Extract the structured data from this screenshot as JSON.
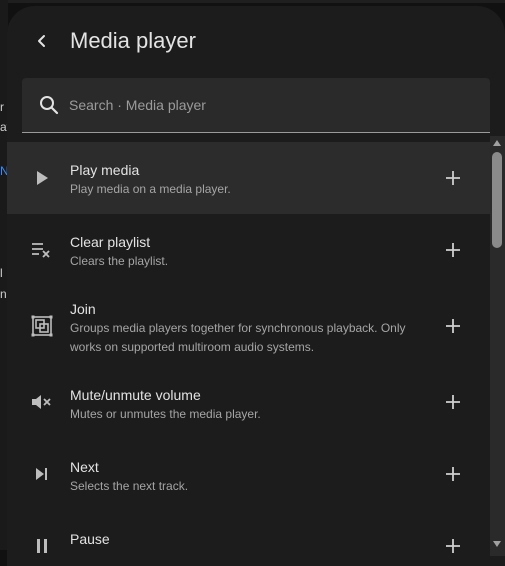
{
  "background": {
    "fragments": [
      "r",
      "at",
      "N",
      "l",
      "ni"
    ]
  },
  "dialog": {
    "title": "Media player",
    "back_icon": "chevron-left-icon"
  },
  "search": {
    "placeholder": "Search · Media player",
    "value": "",
    "icon": "search-icon"
  },
  "items": [
    {
      "title": "Play media",
      "description": "Play media on a media player.",
      "icon": "play-icon",
      "selected": true
    },
    {
      "title": "Clear playlist",
      "description": "Clears the playlist.",
      "icon": "playlist-remove-icon"
    },
    {
      "title": "Join",
      "description": "Groups media players together for synchronous playback. Only works on supported multiroom audio systems.",
      "icon": "speaker-group-icon"
    },
    {
      "title": "Mute/unmute volume",
      "description": "Mutes or unmutes the media player.",
      "icon": "volume-mute-icon"
    },
    {
      "title": "Next",
      "description": "Selects the next track.",
      "icon": "skip-next-icon"
    },
    {
      "title": "Pause",
      "description": "",
      "icon": "pause-icon"
    }
  ],
  "add_icon": "plus-icon",
  "colors": {
    "dialog_bg": "#1c1c1c",
    "selected_row_bg": "#2c2c2c",
    "link_blue": "#3b8cff"
  }
}
